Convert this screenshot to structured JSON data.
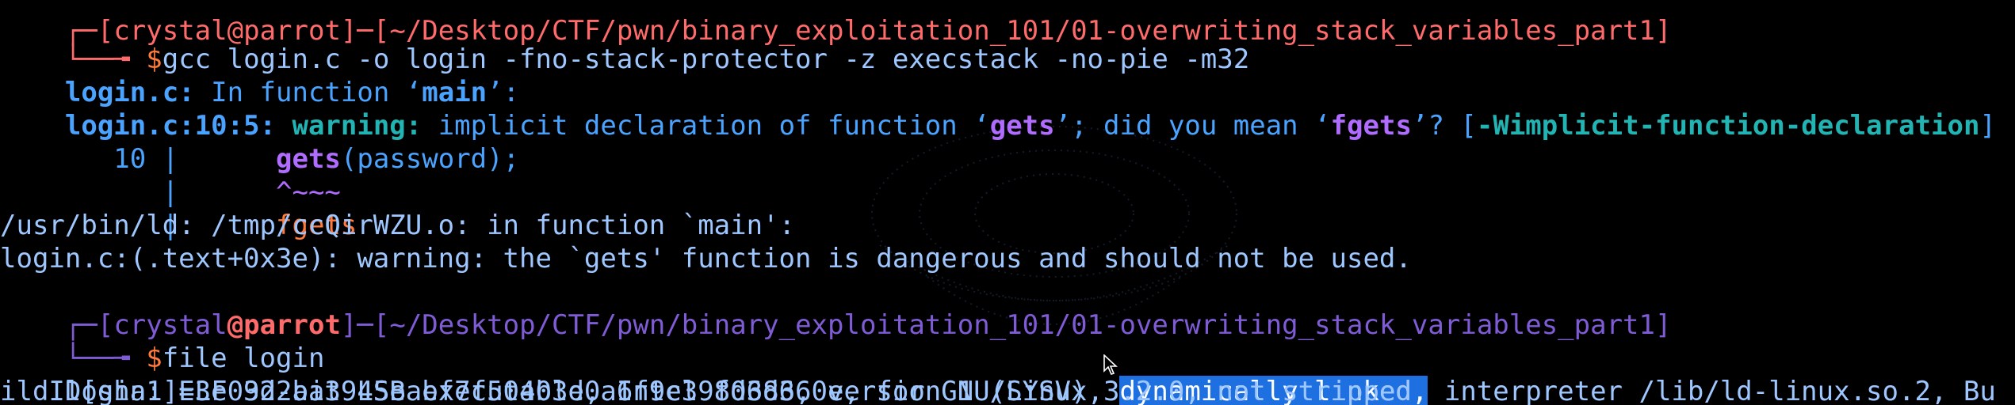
{
  "terminal": {
    "line0": {
      "prefix": "┌─[",
      "user": "crystal",
      "at": "@",
      "host": "parrot",
      "mid": "]─[",
      "path": "~/Desktop/CTF/pwn/binary_exploitation_101/01-overwriting_stack_variables_part1",
      "suffix": "]"
    },
    "line1": {
      "prompt": "└──╼ ",
      "dollar": "$",
      "command": "gcc login.c -o login -fno-stack-protector -z execstack -no-pie -m32"
    },
    "line2": {
      "file": "login.c:",
      "text": " In function ",
      "q1": "‘",
      "fn": "main",
      "q2": "’",
      "end": ":"
    },
    "line3": {
      "loc": "login.c:10:5:",
      "warn": " warning:",
      "t1": " implicit declaration of function ",
      "q1": "‘",
      "fn": "gets",
      "q2": "’",
      "t2": "; did you mean ",
      "q3": "‘",
      "fn2": "fgets",
      "q4": "’",
      "t3": "? ",
      "b1": "[",
      "flag": "-Wimplicit-function-declaration",
      "b2": "]"
    },
    "line4": {
      "num": "   10 | ",
      "indent": "     ",
      "fn": "gets",
      "rest": "(password);"
    },
    "line5": {
      "bar": "      | ",
      "indent": "     ",
      "caret": "^~~~"
    },
    "line6": {
      "bar": "      | ",
      "indent": "     ",
      "fix": "fgets"
    },
    "line7": "/usr/bin/ld: /tmp/ccQirWZU.o: in function `main':",
    "line8": "login.c:(.text+0x3e): warning: the `gets' function is dangerous and should not be used.",
    "line9": {
      "prefix": "┌─[",
      "user": "crystal",
      "at": "@",
      "host": "parrot",
      "mid": "]─[",
      "path": "~/Desktop/CTF/pwn/binary_exploitation_101/01-overwriting_stack_variables_part1",
      "suffix": "]"
    },
    "line10": {
      "prompt": "└──╼ ",
      "dollar": "$",
      "command": "file login"
    },
    "line11": {
      "before": "login: ELF 32-bit LSB executable, Intel 80386, version 1 (SYSV), ",
      "selected": "dynamically linked,",
      "after": " interpreter /lib/ld-linux.so.2, Bu"
    },
    "line12": "ildID[sha1]=3e09d2aa3945eabf7f50403d0a6f9c39fd6d360e, for GNU/Linux 3.2.0, not stripped"
  },
  "colors": {
    "background": "#000000",
    "text": "#4aa3ff",
    "host": "#ff6a6a",
    "selection": "#1e6fe0"
  },
  "icons": {
    "cursor": "mouse-pointer-icon"
  }
}
